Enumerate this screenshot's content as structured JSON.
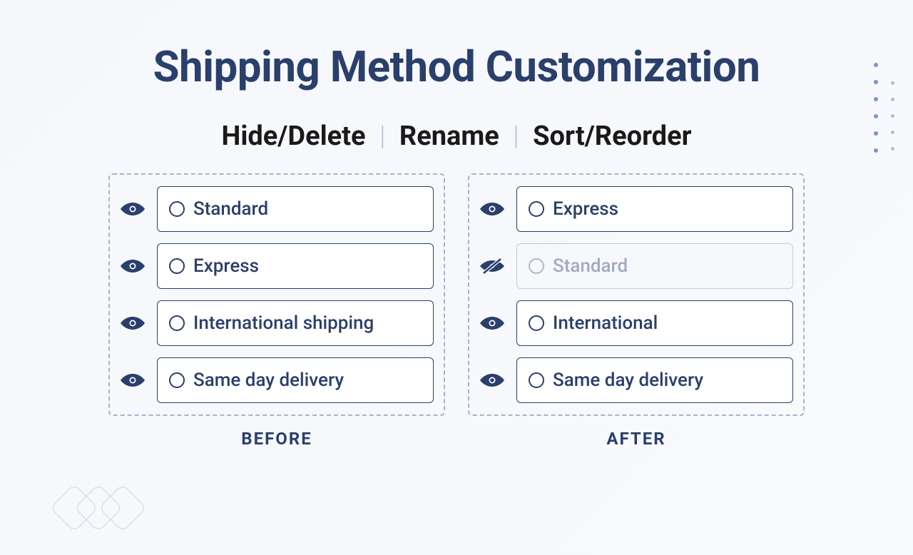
{
  "title": "Shipping Method Customization",
  "subtitle": {
    "hide": "Hide/Delete",
    "rename": "Rename",
    "sort": "Sort/Reorder"
  },
  "before": {
    "caption": "BEFORE",
    "items": [
      {
        "label": "Standard",
        "visible": true
      },
      {
        "label": "Express",
        "visible": true
      },
      {
        "label": "International shipping",
        "visible": true
      },
      {
        "label": "Same day delivery",
        "visible": true
      }
    ]
  },
  "after": {
    "caption": "AFTER",
    "items": [
      {
        "label": "Express",
        "visible": true
      },
      {
        "label": "Standard",
        "visible": false
      },
      {
        "label": "International",
        "visible": true
      },
      {
        "label": "Same day delivery",
        "visible": true
      }
    ]
  }
}
